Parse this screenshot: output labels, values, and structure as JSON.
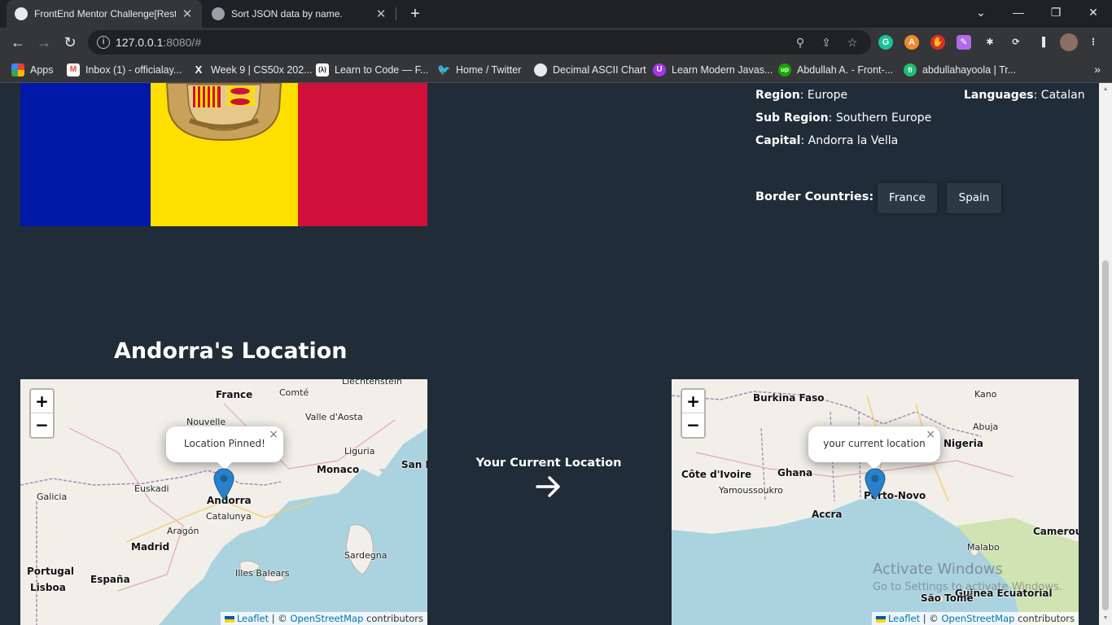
{
  "browser": {
    "tabs": [
      {
        "title": "FrontEnd Mentor Challenge[Rest",
        "favicon": "globe-icon",
        "active": true
      },
      {
        "title": "Sort JSON data by name.",
        "favicon": "openai-icon",
        "active": false
      }
    ],
    "url_host": "127.0.0.1",
    "url_rest": ":8080/#",
    "bookmarks": [
      {
        "label": "Apps",
        "icon": "apps-grid-icon"
      },
      {
        "label": "Inbox (1) - officialay...",
        "icon": "gmail-icon"
      },
      {
        "label": "Week 9 | CS50x 202...",
        "icon": "x-logo-icon"
      },
      {
        "label": "Learn to Code — F...",
        "icon": "freecodecamp-icon"
      },
      {
        "label": "Home / Twitter",
        "icon": "twitter-icon"
      },
      {
        "label": "Decimal ASCII Chart",
        "icon": "globe-icon"
      },
      {
        "label": "Learn Modern Javas...",
        "icon": "udemy-icon"
      },
      {
        "label": "Abdullah A. - Front-...",
        "icon": "upwork-icon"
      },
      {
        "label": "abdullahayoola | Tr...",
        "icon": "fiverr-icon"
      }
    ]
  },
  "country": {
    "name": "Andorra",
    "flag_colors": [
      "#0018a8",
      "#fedf00",
      "#d0103a"
    ],
    "details": {
      "region_label": "Region",
      "region": "Europe",
      "subregion_label": "Sub Region",
      "subregion": "Southern Europe",
      "capital_label": "Capital",
      "capital": "Andorra la Vella",
      "languages_label": "Languages",
      "languages": "Catalan"
    },
    "border_label": "Border Countries:",
    "borders": [
      "France",
      "Spain"
    ]
  },
  "location": {
    "title": "Andorra's Location",
    "current_location_label": "Your Current Location"
  },
  "maps": {
    "left": {
      "popup": "Location Pinned!",
      "labels": [
        "France",
        "Liechtenstein",
        "Nouvelle",
        "Monaco",
        "San M",
        "Andorra",
        "Catalunya",
        "Madrid",
        "Portugal",
        "España",
        "Lisboa",
        "Galicia",
        "Illes Balears",
        "Sardegna",
        "Aragón",
        "Comté",
        "Valle d'Aosta",
        "Liguria",
        "Euskadi"
      ]
    },
    "right": {
      "popup": "your current location",
      "labels": [
        "Burkina Faso",
        "Nigeria",
        "Côte d'Ivoire",
        "Ghana",
        "Yamoussoukro",
        "Porto-Novo",
        "Accra",
        "Malabo",
        "Cameroun",
        "Guinea Ecuatorial",
        "São Tomé",
        "Kano",
        "Abuja"
      ]
    },
    "zoom_in": "+",
    "zoom_out": "−",
    "attribution": {
      "leaflet": "Leaflet",
      "sep": " | © ",
      "osm": "OpenStreetMap",
      "tail": " contributors"
    }
  },
  "os_watermark": {
    "line1": "Activate Windows",
    "line2": "Go to Settings to activate Windows."
  }
}
